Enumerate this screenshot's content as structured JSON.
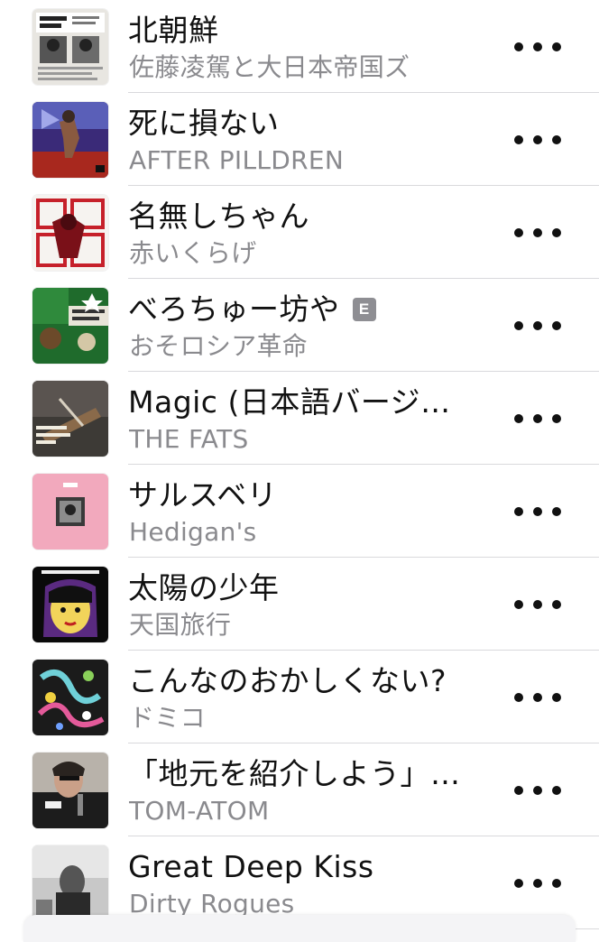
{
  "songs": [
    {
      "title": "北朝鮮",
      "artist": "佐藤凌駕と大日本帝国ズ",
      "explicit": false,
      "art_icon": "album-art-newspaper"
    },
    {
      "title": "死に損ない",
      "artist": "AFTER PILLDREN",
      "explicit": false,
      "art_icon": "album-art-figure-red"
    },
    {
      "title": "名無しちゃん",
      "artist": "赤いくらげ",
      "explicit": false,
      "art_icon": "album-art-red-kanji"
    },
    {
      "title": "べろちゅー坊や",
      "artist": "おそロシア革命",
      "explicit": true,
      "explicit_label": "E",
      "art_icon": "album-art-green-collage"
    },
    {
      "title": "Magic (日本語バージ…",
      "artist": "THE FATS",
      "explicit": false,
      "art_icon": "album-art-school-trip"
    },
    {
      "title": "サルスベリ",
      "artist": "Hedigan's",
      "explicit": false,
      "art_icon": "album-art-pink"
    },
    {
      "title": "太陽の少年",
      "artist": "天国旅行",
      "explicit": false,
      "art_icon": "album-art-face"
    },
    {
      "title": "こんなのおかしくない?",
      "artist": "ドミコ",
      "explicit": false,
      "art_icon": "album-art-pattern"
    },
    {
      "title": "「地元を紹介しよう」…",
      "artist": "TOM-ATOM",
      "explicit": false,
      "art_icon": "album-art-singer-photo"
    },
    {
      "title": "Great Deep Kiss",
      "artist": "Dirty Rogues",
      "explicit": false,
      "art_icon": "album-art-bw-photo"
    }
  ],
  "more_icon": "ellipsis-icon",
  "colors": {
    "title": "#111111",
    "artist": "#8a8a8e",
    "separator": "#d9d9dc",
    "explicit_badge": "#8e8e93"
  }
}
